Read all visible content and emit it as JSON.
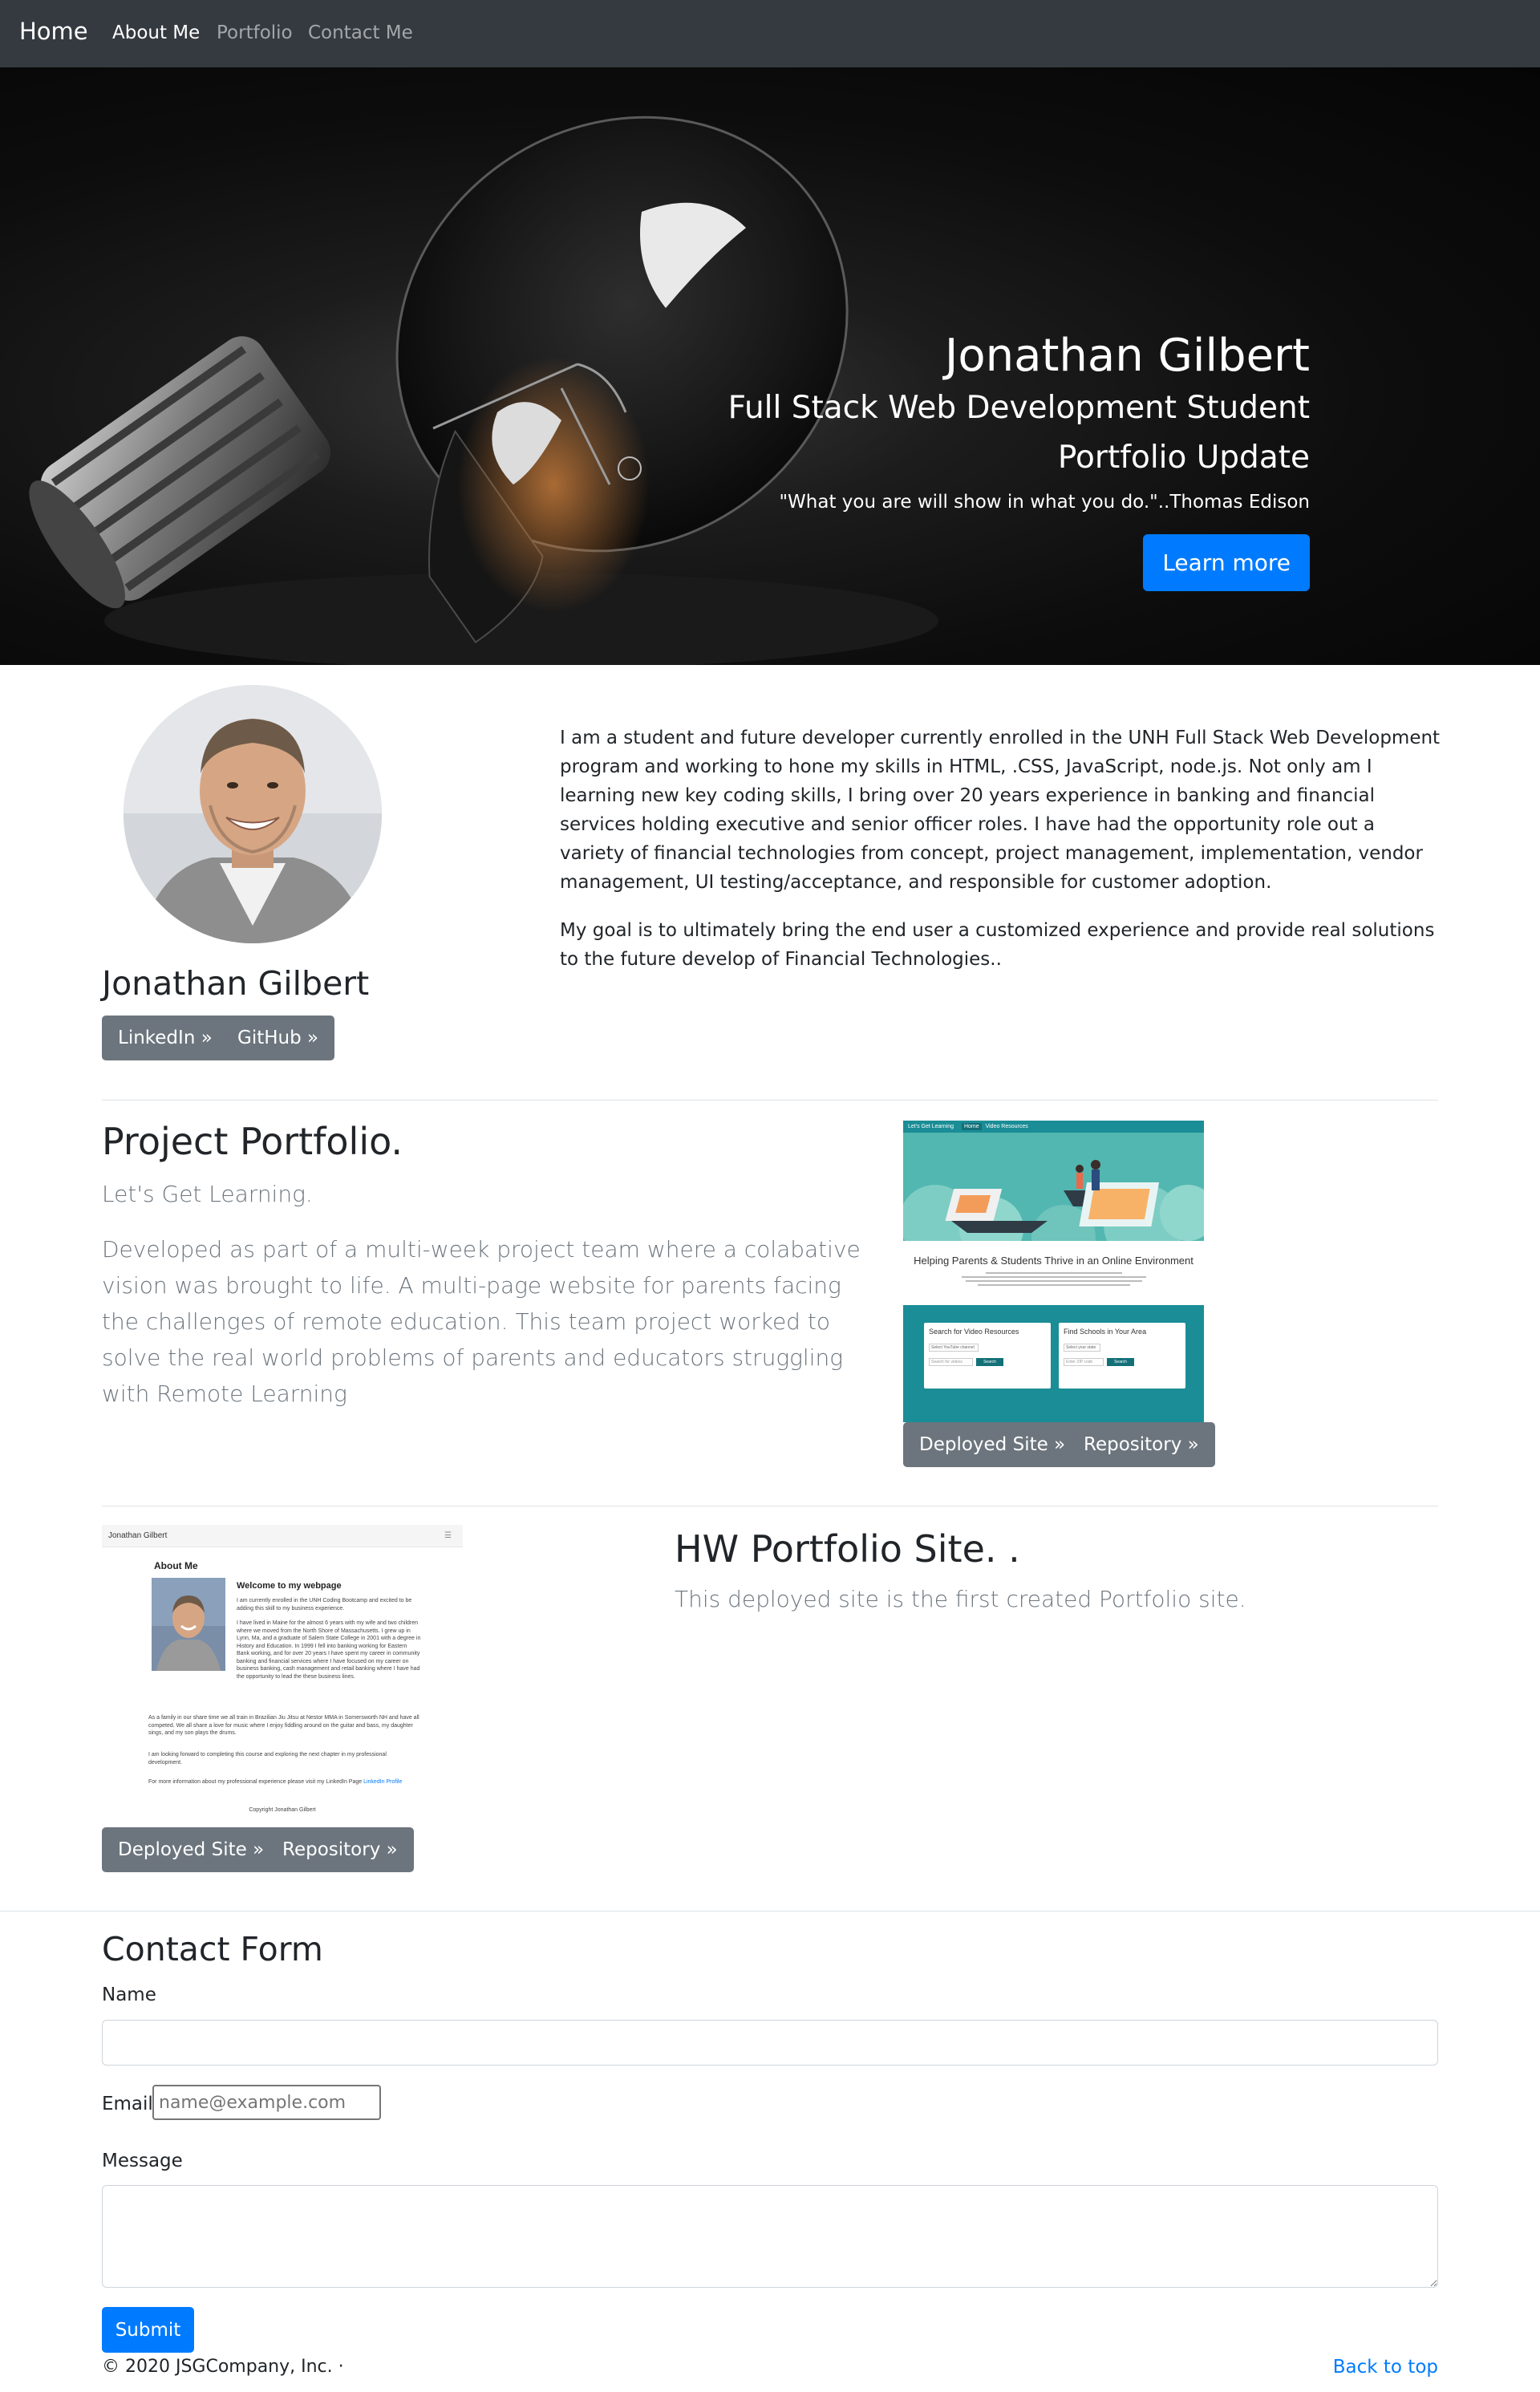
{
  "nav": {
    "brand": "Home",
    "links": [
      "About Me",
      "Portfolio",
      "Contact Me"
    ]
  },
  "hero": {
    "title": "Jonathan Gilbert",
    "subtitle1": "Full Stack Web Development Student",
    "subtitle2": "Portfolio Update",
    "quote": "\"What you are will show in what you do.\"..Thomas Edison",
    "cta_label": "Learn more"
  },
  "about": {
    "name": "Jonathan Gilbert",
    "linkedin_label": "LinkedIn »",
    "github_label": "GitHub »",
    "para1": "I am a student and future developer currently enrolled in the UNH Full Stack Web Development program and working to hone my skills in HTML, .CSS, JavaScript, node.js. Not only am I learning new key coding skills, I bring over 20 years experience in banking and financial services holding executive and senior officer roles. I have had the opportunity role out a variety of financial technologies from concept, project management, implementation, vendor management, UI testing/acceptance, and responsible for customer adoption.",
    "para2": "My goal is to ultimately bring the end user a customized experience and provide real solutions to the future develop of Financial Technologies.."
  },
  "project1": {
    "title": "Project Portfolio.",
    "subtitle": "Let's Get Learning.",
    "description": "Developed as part of a multi-week project team where a colabative vision was brought to life. A multi-page website for parents facing the challenges of remote education. This team project worked to solve the real world problems of parents and educators struggling with Remote Learning",
    "deployed_label": "Deployed Site »",
    "repo_label": "Repository »",
    "screenshot": {
      "nav_brand": "Let's Get Learning",
      "nav_items": [
        "Home",
        "Video Resources"
      ],
      "heading": "Helping Parents & Students Thrive in an Online Environment",
      "card1_title": "Search for Video Resources",
      "card2_title": "Find Schools in Your Area",
      "card_button": "Search",
      "card1_select": "Select YouTube channel",
      "card1_input": "Search for videos",
      "card2_select": "Select your state",
      "card2_input": "Enter ZIP code"
    }
  },
  "project2": {
    "title": "HW Portfolio Site. .",
    "subtitle": "This deployed site is the first created Portfolio site.",
    "deployed_label": "Deployed Site »",
    "repo_label": "Repository »",
    "screenshot": {
      "nav_brand": "Jonathan Gilbert",
      "menu_glyph": "☰",
      "section": "About Me",
      "heading": "Welcome to my webpage",
      "paragraphs": [
        "I am currently enrolled in the UNH Coding Bootcamp and excited to be adding this skill to my business experience.",
        "I have lived in Maine for the almost 6 years with my wife and two children where we moved from the North Shore of Massachusetts. I grew up in Lynn, Ma, and a graduate of Salem State College in 2001 with a degree in History and Education. In 1999 I fell into banking working for Eastern Bank working, and for over 20 years I have spent my career in community banking and financial services where I have focused on my career on business banking, cash management and retail banking where I have had the opportunity to lead the these business lines.",
        "As a family in our share time we all train in Brazilian Jiu Jitsu at Nestor MMA in Somersworth NH and have all competed. We all share a love for music where I enjoy fiddling around on the guitar and bass, my daughter sings, and my son plays the drums.",
        "I am looking forward to completing this course and exploring the next chapter in my professional development.",
        "For more information about my professional experience please visit my LinkedIn Page"
      ],
      "linkedin_link": "LinkedIn Profile",
      "copyright": "Copyright Jonathan Gilbert"
    }
  },
  "contact": {
    "title": "Contact Form",
    "name_label": "Name",
    "email_label": "Email",
    "email_placeholder": "name@example.com",
    "message_label": "Message",
    "submit_label": "Submit"
  },
  "footer": {
    "copyright": "© 2020 JSGCompany, Inc. ·",
    "back_to_top": "Back to top"
  },
  "colors": {
    "navbar_bg": "#343a40",
    "primary": "#007bff",
    "secondary_btn": "#6c757d",
    "teal": "#1a8d96"
  }
}
